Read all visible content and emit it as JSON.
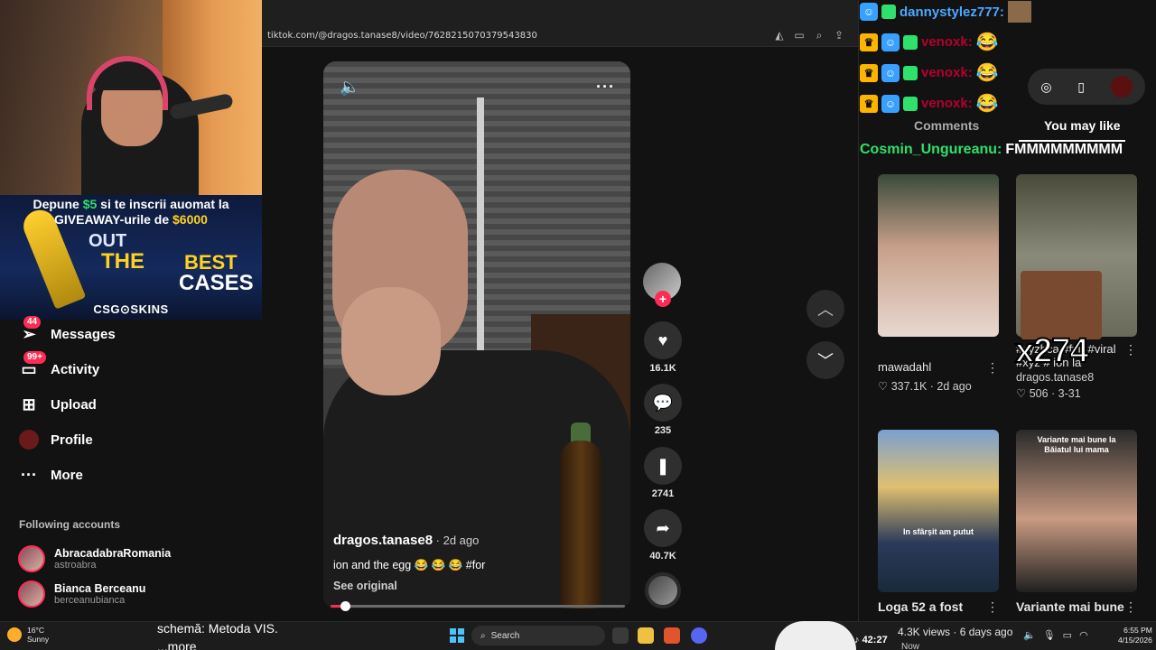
{
  "browser": {
    "url": "tiktok.com/@dragos.tanase8/video/7628215070379543830"
  },
  "stream_overlay": {
    "promo_line1_pre": "Depune ",
    "promo_amount1": "$5",
    "promo_line1_post": " si te inscrii auomat la",
    "promo_line2_pre": "GIVEAWAY-urile de ",
    "promo_amount2": "$6000",
    "promo_out": "OUT",
    "promo_the": "THE",
    "promo_best": "BEST",
    "promo_cases": "CASES",
    "promo_brand": "CSG⊙SKINS"
  },
  "sidebar": {
    "items": [
      {
        "label": "Messages",
        "badge": "44",
        "icon": "paper-plane-icon"
      },
      {
        "label": "Activity",
        "badge": "99+",
        "icon": "inbox-icon"
      },
      {
        "label": "Upload",
        "icon": "plus-square-icon"
      },
      {
        "label": "Profile",
        "icon": "avatar"
      },
      {
        "label": "More",
        "icon": "ellipsis-icon"
      }
    ],
    "following_title": "Following accounts",
    "following": [
      {
        "name": "AbracadabraRomania",
        "handle": "astroabra"
      },
      {
        "name": "Bianca Berceanu",
        "handle": "berceanubianca"
      }
    ]
  },
  "video": {
    "username": "dragos.tanase8",
    "date": " · 2d ago",
    "caption": "ion and the egg 😂 😂 😂 #for",
    "see_original": "See original",
    "progress": 0.05,
    "likes": "16.1K",
    "comments": "235",
    "saves": "2741",
    "shares": "40.7K"
  },
  "chat": {
    "top_user": "dannystylez777:",
    "lines": [
      {
        "user": "venoxk:",
        "emoji": "😂"
      },
      {
        "user": "venoxk:",
        "emoji": "😂"
      },
      {
        "user": "venoxk:",
        "emoji": "😂"
      }
    ],
    "cosmin_user": "Cosmin_Ungureanu:",
    "cosmin_msg": "FMMMMMMMMM",
    "user_color": "#b4002e",
    "green_color": "#2fe06a",
    "top_color": "#4aa8ff"
  },
  "right_panel": {
    "tab_comments": "Comments",
    "tab_like": "You may like",
    "overlay_text": "x274",
    "cards": [
      {
        "title": "mawadahl",
        "likes": "337.1K",
        "date": "2d ago"
      },
      {
        "title": "#xyzbca #fyp #viral #xyz # ion la tirbomba",
        "author": "dragos.tanase8",
        "likes": "506",
        "date": "3-31"
      },
      {
        "title": "Loga 52 a fost",
        "caption": "In sfârșit am putut"
      },
      {
        "title": "Variante mai bune",
        "caption": "Variante mai bune la Băiatul lui mama"
      }
    ]
  },
  "taskbar": {
    "weather_temp": "16°C",
    "weather_desc": "Sunny",
    "schema_line1": "schemă: Metoda VIS.",
    "schema_line2": "...more",
    "search": "Search",
    "clip_time": "42:27",
    "views": "4.3K views · 6 days ago",
    "now_label": "Now",
    "time": "6:55 PM",
    "date": "4/15/2026"
  }
}
